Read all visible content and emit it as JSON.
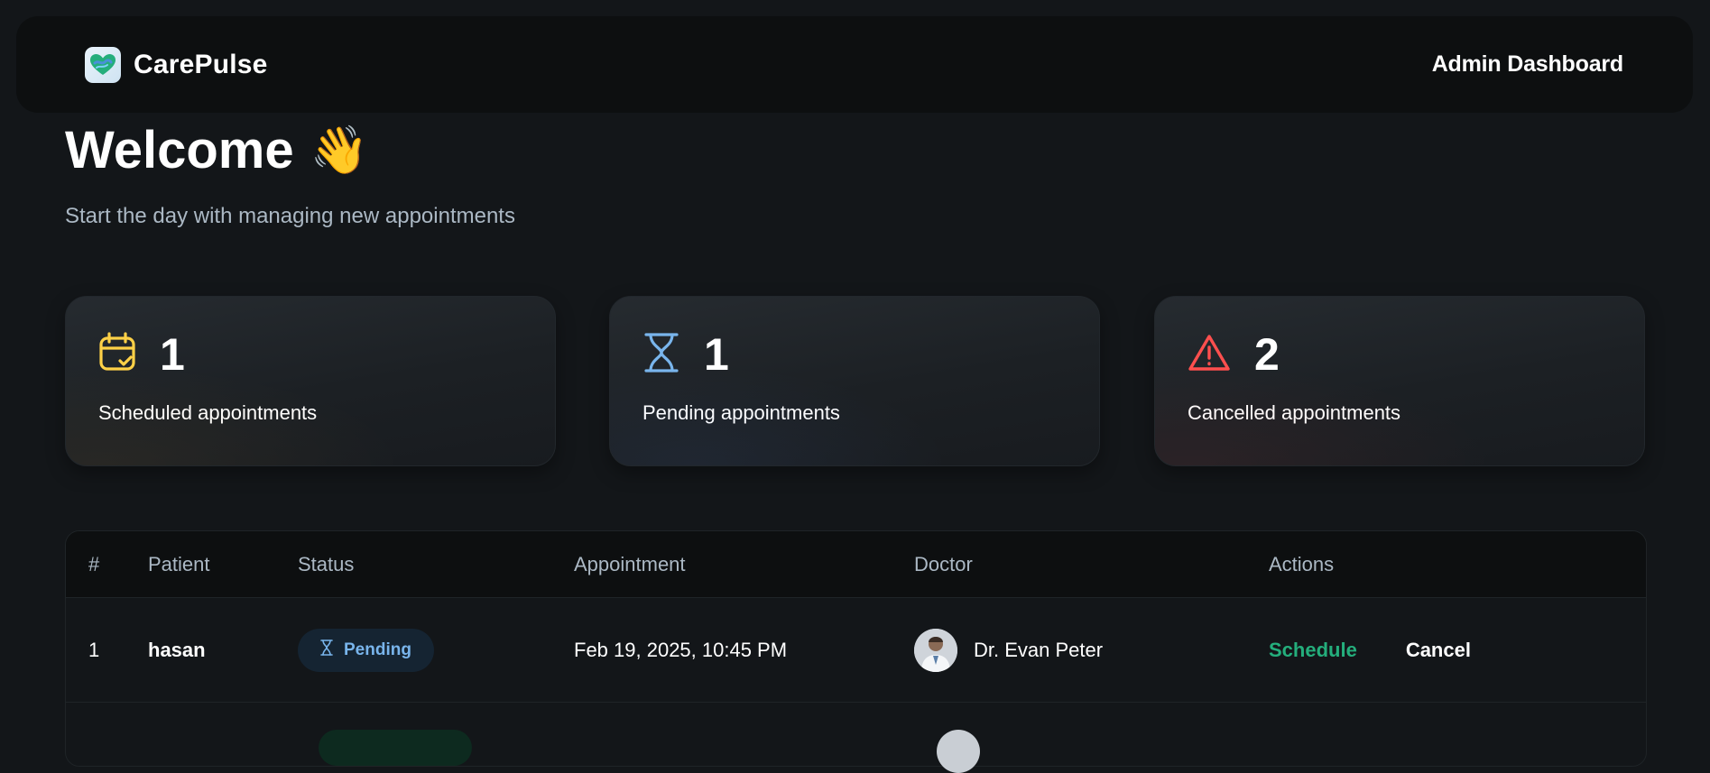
{
  "header": {
    "brand_name": "CarePulse",
    "title": "Admin Dashboard"
  },
  "welcome": {
    "title": "Welcome",
    "emoji": "👋",
    "subtitle": "Start the day with managing new appointments"
  },
  "stats": [
    {
      "count": "1",
      "label": "Scheduled appointments",
      "icon": "calendar-check-icon",
      "color": "#ffd147"
    },
    {
      "count": "1",
      "label": "Pending appointments",
      "icon": "hourglass-icon",
      "color": "#79b5ec"
    },
    {
      "count": "2",
      "label": "Cancelled appointments",
      "icon": "warning-icon",
      "color": "#ff4f4e"
    }
  ],
  "table": {
    "headers": [
      "#",
      "Patient",
      "Status",
      "Appointment",
      "Doctor",
      "Actions"
    ],
    "rows": [
      {
        "num": "1",
        "patient": "hasan",
        "status": "Pending",
        "appointment": "Feb 19, 2025, 10:45 PM",
        "doctor": "Dr. Evan Peter",
        "schedule_label": "Schedule",
        "cancel_label": "Cancel"
      }
    ]
  },
  "colors": {
    "background": "#131619",
    "panel": "#0d0f10",
    "accent_green": "#24ae7c",
    "pending_blue": "#79b5ec",
    "muted_text": "#abb8c4"
  }
}
